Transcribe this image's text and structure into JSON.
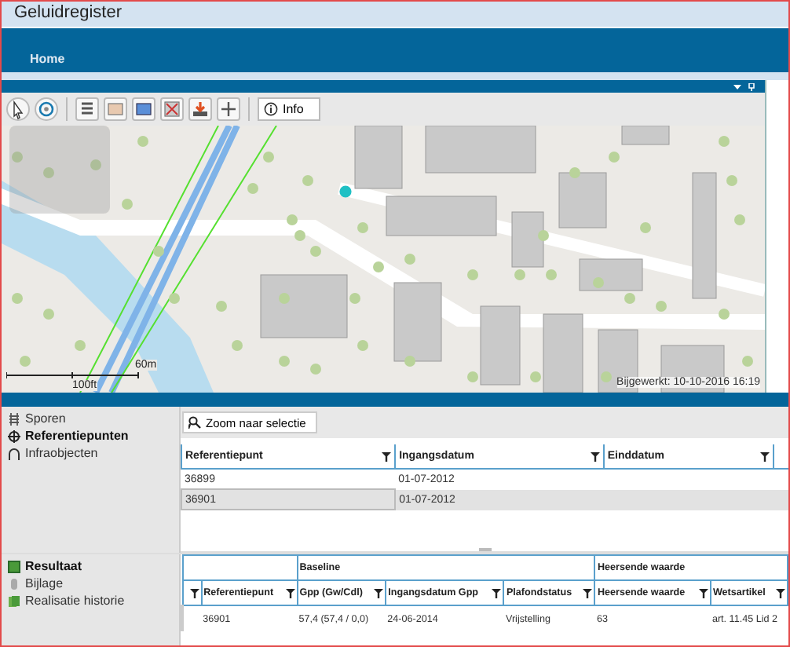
{
  "window": {
    "title": "Geluidregister"
  },
  "nav": {
    "items": [
      {
        "label": "Home"
      }
    ]
  },
  "toolbar": {
    "info_button": "Info"
  },
  "map": {
    "scale": {
      "metric": "60m",
      "imperial": "100ft"
    },
    "updated": "Bijgewerkt: 10-10-2016 16:19"
  },
  "sidebar_top": {
    "items": [
      {
        "label": "Sporen",
        "kind": "tracks",
        "selected": false
      },
      {
        "label": "Referentiepunten",
        "kind": "points",
        "selected": true
      },
      {
        "label": "Infraobjecten",
        "kind": "infra",
        "selected": false
      }
    ]
  },
  "ref_table": {
    "action": "Zoom naar selectie",
    "columns": [
      "Referentiepunt",
      "Ingangsdatum",
      "Einddatum"
    ],
    "rows": [
      {
        "cells": [
          "36899",
          "01-07-2012"
        ],
        "selected": false
      },
      {
        "cells": [
          "36901",
          "01-07-2012"
        ],
        "selected": true
      }
    ]
  },
  "sidebar_bottom": {
    "items": [
      {
        "label": "Resultaat",
        "kind": "result",
        "selected": true
      },
      {
        "label": "Bijlage",
        "kind": "attachment",
        "selected": false
      },
      {
        "label": "Realisatie historie",
        "kind": "history",
        "selected": false
      }
    ]
  },
  "result_table": {
    "ungrouped_columns": [
      "Referentiepunt"
    ],
    "groups": [
      {
        "label": "Baseline",
        "columns": [
          "Gpp (Gw/Cdl)",
          "Ingangsdatum Gpp",
          "Plafondstatus"
        ]
      },
      {
        "label": "Heersende waarde",
        "columns": [
          "Heersende waarde",
          "Wetsartikel"
        ]
      }
    ],
    "rows": [
      {
        "cells": [
          "36901",
          "57,4 (57,4 / 0,0)",
          "24-06-2014",
          "Vrijstelling",
          "63",
          "art. 11.45 Lid 2"
        ]
      }
    ]
  }
}
